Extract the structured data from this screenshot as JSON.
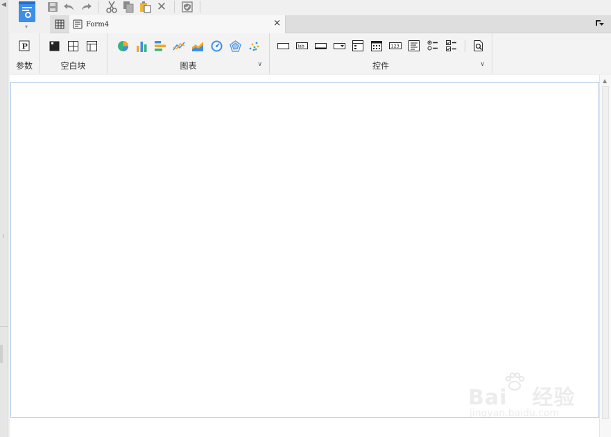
{
  "window": {
    "collapse_arrow": "◀",
    "splitter_grip": "⁞"
  },
  "app_menu": {
    "icon": "report-doc-icon",
    "chevron": "▾"
  },
  "quick_toolbar": {
    "items": [
      {
        "name": "save-icon",
        "label": ""
      },
      {
        "name": "undo-icon",
        "label": ""
      },
      {
        "name": "redo-icon",
        "label": ""
      },
      {
        "name": "cut-icon",
        "label": ""
      },
      {
        "name": "copy-icon",
        "label": ""
      },
      {
        "name": "paste-icon",
        "label": ""
      },
      {
        "name": "delete-icon",
        "label": "✕"
      },
      {
        "name": "shield-icon",
        "label": ""
      }
    ]
  },
  "tabs": {
    "grid_button_icon": "grid-icon",
    "active": {
      "label": "Form4",
      "icon": "form-icon",
      "close": "×"
    },
    "menu_glyph": "▾"
  },
  "ribbon": {
    "groups": [
      {
        "id": "param",
        "label": "参数",
        "icons": [
          "parameter-icon"
        ]
      },
      {
        "id": "blank",
        "label": "空白块",
        "icons": [
          "absolute-block-icon",
          "split-block-icon",
          "tab-block-icon"
        ]
      },
      {
        "id": "chart",
        "label": "图表",
        "expand": "∨",
        "icons": [
          "pie-chart-icon",
          "bar-chart-icon",
          "horizontal-bar-chart-icon",
          "line-chart-icon",
          "area-chart-icon",
          "gauge-chart-icon",
          "radar-chart-icon",
          "scatter-chart-icon"
        ]
      },
      {
        "id": "widget",
        "label": "控件",
        "expand": "∨",
        "icons": [
          "button-widget-icon",
          "label-widget-icon",
          "text-field-widget-icon",
          "dropdown-widget-icon",
          "dropdown-tree-widget-icon",
          "date-widget-icon",
          "number-widget-icon",
          "textarea-widget-icon",
          "radio-group-widget-icon",
          "checkbox-group-widget-icon",
          "search-widget-icon"
        ]
      }
    ]
  },
  "colors": {
    "accent_blue": "#3c8ee6",
    "chart_green": "#36b37e",
    "chart_orange": "#f5a623",
    "canvas_border": "#a8c4e6"
  },
  "watermark": {
    "text": "Bai",
    "text2": "经验",
    "url": "jingyan.baidu.com"
  }
}
